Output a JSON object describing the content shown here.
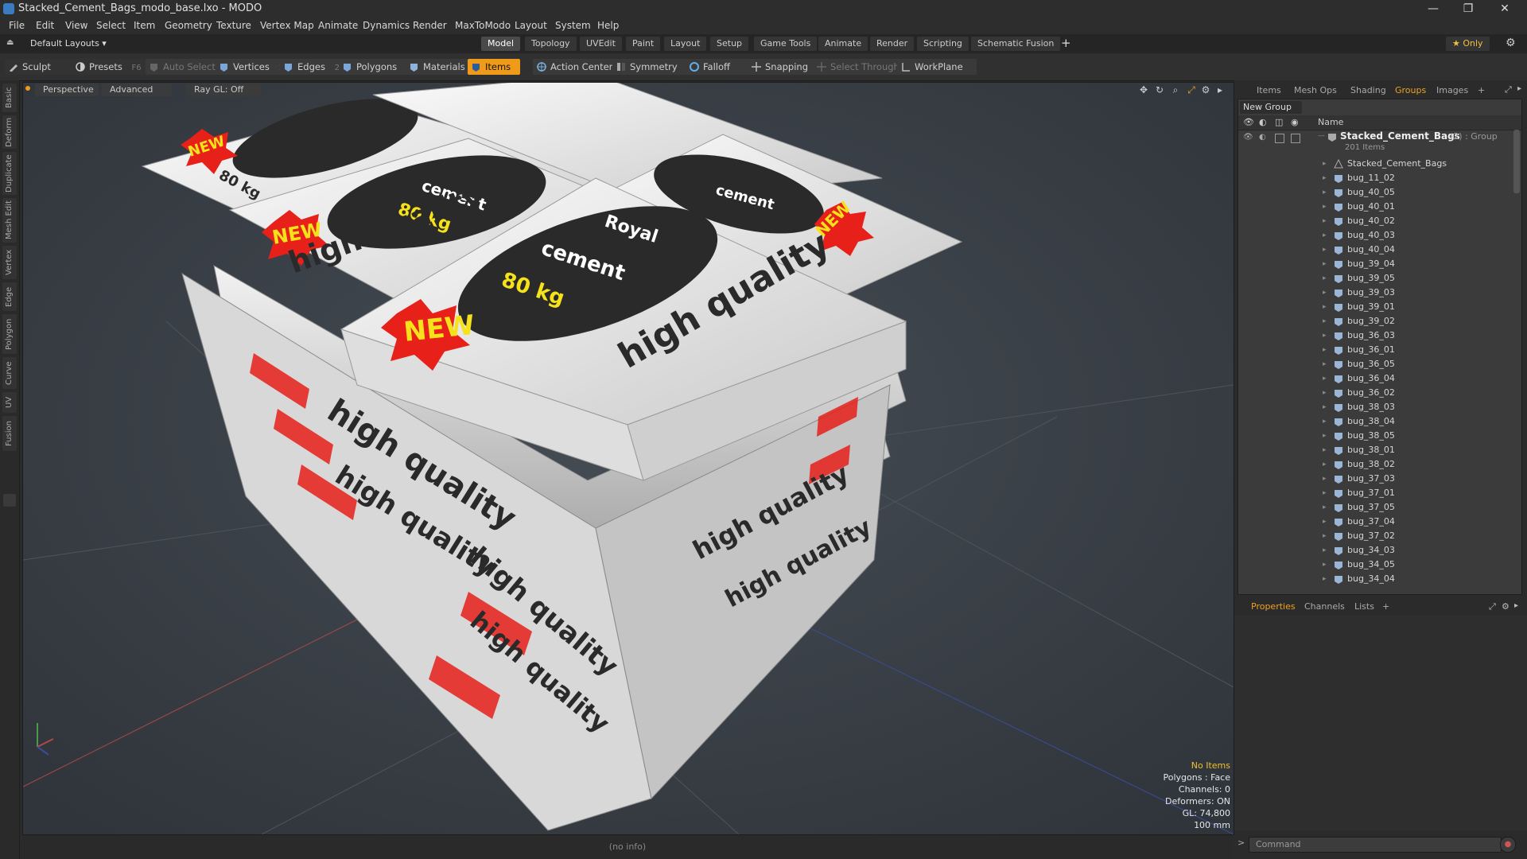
{
  "window": {
    "title": "Stacked_Cement_Bags_modo_base.lxo - MODO",
    "controls": [
      "—",
      "❐",
      "✕"
    ]
  },
  "menu": [
    "File",
    "Edit",
    "View",
    "Select",
    "Item",
    "Geometry",
    "Texture",
    "Vertex Map",
    "Animate",
    "Dynamics",
    "Render",
    "MaxToModo",
    "Layout",
    "System",
    "Help"
  ],
  "layout_selector": "Default Layouts ▾",
  "layout_tabs": [
    "Model",
    "Topology",
    "UVEdit",
    "Paint",
    "Layout",
    "Setup",
    "Game Tools",
    "Animate",
    "Render",
    "Scripting",
    "Schematic Fusion",
    "+"
  ],
  "only_button": "★  Only",
  "toolbar": {
    "sculpt": "Sculpt",
    "presets": "Presets",
    "presets_key": "F6",
    "auto_select": "Auto Select",
    "vertices": "Vertices",
    "vertices_count": "1",
    "edges": "Edges",
    "edges_count": "2",
    "polygons": "Polygons",
    "materials": "Materials",
    "items": "Items",
    "action_center": "Action Center",
    "symmetry": "Symmetry",
    "falloff": "Falloff",
    "snapping": "Snapping",
    "select_through": "Select Through",
    "workplane": "WorkPlane"
  },
  "left_tabs": [
    "Basic",
    "Deform",
    "Duplicate",
    "Mesh Edit",
    "Vertex",
    "Edge",
    "Polygon",
    "Curve",
    "UV",
    "Fusion"
  ],
  "viewport": {
    "view": "Perspective",
    "mode": "Advanced",
    "raygl": "Ray GL: Off",
    "stats": {
      "selection": "No Items",
      "polygons": "Polygons : Face",
      "channels": "Channels: 0",
      "deformers": "Deformers: ON",
      "gl": "GL: 74,800",
      "unit": "100 mm"
    },
    "status": "(no info)",
    "bag_text": {
      "brand": "Royal",
      "product": "cement",
      "weight": "80 kg",
      "badge": "NEW",
      "slogan": "high quality"
    }
  },
  "right_panel": {
    "tabs": [
      "Items",
      "Mesh Ops",
      "Shading",
      "Groups",
      "Images",
      "+"
    ],
    "active_tab": "Groups",
    "new_group": "New Group",
    "column_name": "Name",
    "group": {
      "name": "Stacked_Cement_Bags",
      "suffix": "(2) : Group",
      "count": "201 Items"
    },
    "items": [
      "Stacked_Cement_Bags",
      "bug_11_02",
      "bug_40_05",
      "bug_40_01",
      "bug_40_02",
      "bug_40_03",
      "bug_40_04",
      "bug_39_04",
      "bug_39_05",
      "bug_39_03",
      "bug_39_01",
      "bug_39_02",
      "bug_36_03",
      "bug_36_01",
      "bug_36_05",
      "bug_36_04",
      "bug_36_02",
      "bug_38_03",
      "bug_38_04",
      "bug_38_05",
      "bug_38_01",
      "bug_38_02",
      "bug_37_03",
      "bug_37_01",
      "bug_37_05",
      "bug_37_04",
      "bug_37_02",
      "bug_34_03",
      "bug_34_05",
      "bug_34_04"
    ],
    "bottom_tabs": [
      "Properties",
      "Channels",
      "Lists",
      "+"
    ],
    "command_placeholder": "Command"
  },
  "colors": {
    "accent": "#f09a1a",
    "bag_red": "#e8201a",
    "bag_yellow": "#f6e21a",
    "bag_dark": "#2a2a2a"
  }
}
